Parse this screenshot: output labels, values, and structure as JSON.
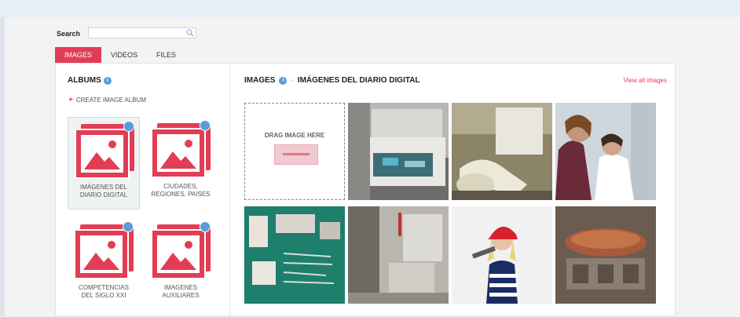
{
  "search": {
    "label": "Search",
    "value": "",
    "placeholder": ""
  },
  "tabs": [
    {
      "label": "IMAGES",
      "active": true
    },
    {
      "label": "VIDEOS",
      "active": false
    },
    {
      "label": "FILES",
      "active": false
    }
  ],
  "sidebar": {
    "title": "ALBUMS",
    "create_label": "CREATE IMAGE ALBUM",
    "albums": [
      {
        "line1": "IMÁGENES DEL",
        "line2": "DIARIO DIGITAL",
        "selected": true
      },
      {
        "line1": "CIUDADES,",
        "line2": "REGIONES, PAISES",
        "selected": false
      },
      {
        "line1": "COMPETENCIAS",
        "line2": "DEL SIGLO XXI",
        "selected": false
      },
      {
        "line1": "IMAGENES",
        "line2": "AUXILIARES",
        "selected": false
      }
    ]
  },
  "main": {
    "section": "IMAGES",
    "album_title": "IMÁGENES DEL DIARIO DIGITAL",
    "view_all": "View all images",
    "drop_label": "DRAG IMAGE HERE",
    "thumbnails": [
      {
        "subject": "dental cabinet drawers"
      },
      {
        "subject": "dental chair"
      },
      {
        "subject": "dentist with patient"
      },
      {
        "subject": "dental instruments on green tray"
      },
      {
        "subject": "clinic room"
      },
      {
        "subject": "woman with red hard hat"
      },
      {
        "subject": "engine parts"
      }
    ]
  },
  "colors": {
    "accent": "#e23d54",
    "info": "#5a9bd8",
    "top_band": "#e8eef8"
  },
  "icons": {
    "search": "search-icon",
    "info": "info-icon",
    "plus": "plus-icon",
    "album_badge": "badge-icon"
  }
}
